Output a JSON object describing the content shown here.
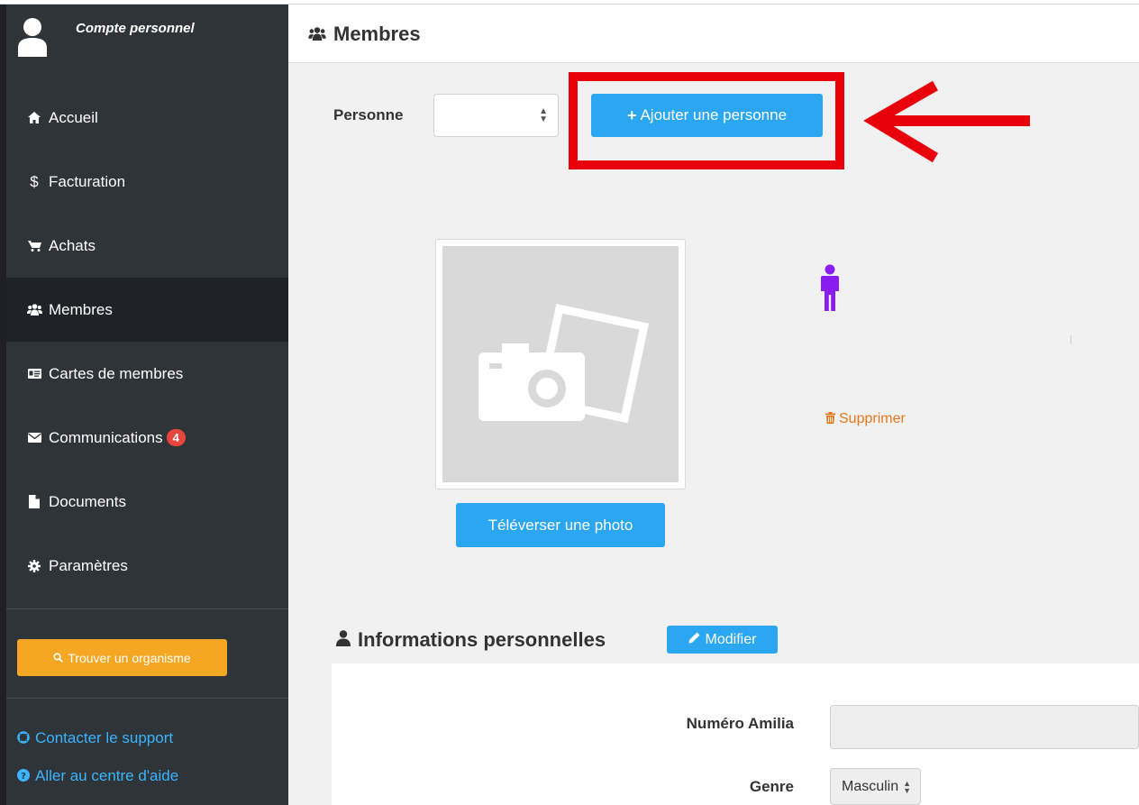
{
  "account": {
    "label": "Compte personnel"
  },
  "sidebar": {
    "items": [
      {
        "label": "Accueil",
        "icon": "home-icon"
      },
      {
        "label": "Facturation",
        "icon": "dollar-icon"
      },
      {
        "label": "Achats",
        "icon": "cart-icon"
      },
      {
        "label": "Membres",
        "icon": "users-icon"
      },
      {
        "label": "Cartes de membres",
        "icon": "id-card-icon"
      },
      {
        "label": "Communications",
        "icon": "envelope-icon",
        "badge": "4"
      },
      {
        "label": "Documents",
        "icon": "file-icon"
      },
      {
        "label": "Paramètres",
        "icon": "gear-icon"
      }
    ],
    "find_button": "Trouver un organisme",
    "support_link": "Contacter le support",
    "help_link": "Aller au centre d'aide"
  },
  "header": {
    "title": "Membres"
  },
  "person": {
    "label": "Personne",
    "add_button": "Ajouter une personne"
  },
  "photo": {
    "upload_button": "Téléverser une photo"
  },
  "delete_link": "Supprimer",
  "personal_info": {
    "title": "Informations personnelles",
    "edit_button": "Modifier",
    "fields": {
      "amilia_number_label": "Numéro Amilia",
      "amilia_number_value": "",
      "gender_label": "Genre",
      "gender_value": "Masculin"
    }
  },
  "colors": {
    "sidebar_bg": "#2f3439",
    "primary_blue": "#2aa7f0",
    "find_orange": "#f5a623",
    "annotation_red": "#e8000b",
    "gender_icon": "#8a1cf0",
    "delete_orange": "#e8781f"
  }
}
